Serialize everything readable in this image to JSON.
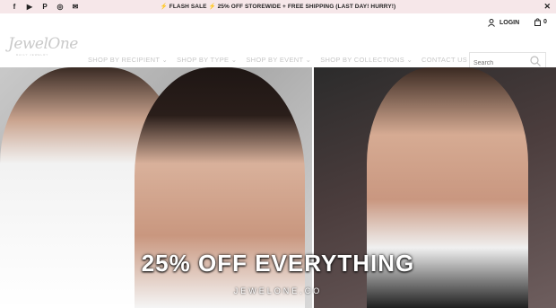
{
  "announcement": {
    "text": "⚡ FLASH SALE ⚡ 25% OFF STOREWIDE + FREE SHIPPING (LAST DAY! HURRY!)",
    "close": "✕"
  },
  "social": {
    "facebook": "f",
    "youtube": "▶",
    "pinterest": "P",
    "instagram": "◎",
    "email": "✉"
  },
  "header": {
    "login": "LOGIN",
    "cart_count": "0"
  },
  "brand": {
    "logo": "JewelOne",
    "tagline": "DAILY JEWELRY"
  },
  "nav": [
    {
      "label": "SHOP BY RECIPIENT",
      "caret": "⌄"
    },
    {
      "label": "SHOP BY TYPE",
      "caret": "⌄"
    },
    {
      "label": "SHOP BY EVENT",
      "caret": "⌄"
    },
    {
      "label": "SHOP BY COLLECTIONS",
      "caret": "⌄"
    },
    {
      "label": "CONTACT US"
    }
  ],
  "search": {
    "placeholder": "Search"
  },
  "hero": {
    "headline": "25% OFF EVERYTHING",
    "subline": "JEWELONE.CO"
  },
  "colors": {
    "topbar_bg": "#f6e7e9",
    "nav_text": "#c7c7c7",
    "text_dark": "#222222"
  }
}
